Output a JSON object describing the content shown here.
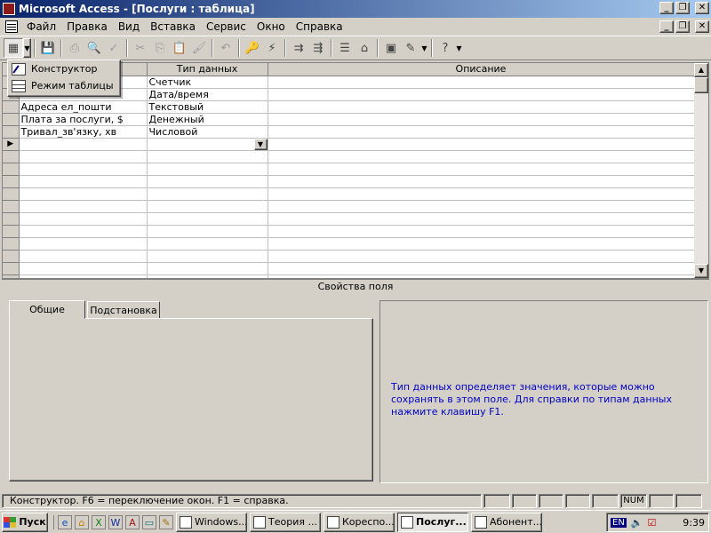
{
  "window": {
    "title": "Microsoft Access - [Послуги : таблица]"
  },
  "menu": [
    {
      "label": "Файл"
    },
    {
      "label": "Правка"
    },
    {
      "label": "Вид"
    },
    {
      "label": "Вставка"
    },
    {
      "label": "Сервис"
    },
    {
      "label": "Окно"
    },
    {
      "label": "Справка"
    }
  ],
  "view_menu": {
    "items": [
      {
        "label": "Конструктор"
      },
      {
        "label": "Режим таблицы"
      }
    ]
  },
  "grid": {
    "columns": [
      "Тип данных",
      "Описание"
    ],
    "rows": [
      {
        "field": "",
        "type": "Счетчик",
        "desc": ""
      },
      {
        "field": "",
        "type": "Дата/время",
        "desc": ""
      },
      {
        "field": "Адреса ел_пошти",
        "type": "Текстовый",
        "desc": ""
      },
      {
        "field": "Плата за послуги, $",
        "type": "Денежный",
        "desc": ""
      },
      {
        "field": "Тривал_зв'язку, хв",
        "type": "Числовой",
        "desc": ""
      }
    ],
    "empty_rows": 11
  },
  "properties": {
    "title": "Свойства поля",
    "tabs": [
      {
        "label": "Общие"
      },
      {
        "label": "Подстановка"
      }
    ],
    "help_text": "Тип данных определяет значения, которые можно сохранять в этом поле.  Для справки по типам данных нажмите клавишу F1."
  },
  "statusbar": {
    "message": "Конструктор.  F6 = переключение окон.  F1 = справка.",
    "num": "NUM"
  },
  "taskbar": {
    "start_label": "Пуск",
    "tasks": [
      {
        "label": "Windows..."
      },
      {
        "label": "Теория ..."
      },
      {
        "label": "Кореспо..."
      },
      {
        "label": "Послуг..."
      },
      {
        "label": "Абонент..."
      }
    ],
    "tray": {
      "lang": "EN",
      "time": "9:39"
    }
  }
}
